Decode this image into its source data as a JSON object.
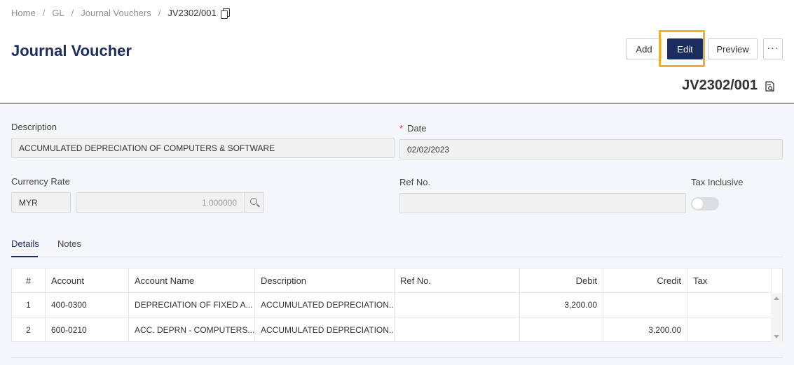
{
  "breadcrumb": {
    "items": [
      "Home",
      "GL",
      "Journal Vouchers"
    ],
    "current": "JV2302/001",
    "separator": "/"
  },
  "page": {
    "title": "Journal Voucher",
    "doc_no": "JV2302/001"
  },
  "toolbar": {
    "add_label": "Add",
    "edit_label": "Edit",
    "preview_label": "Preview",
    "more_label": "···"
  },
  "form": {
    "description_label": "Description",
    "description_value": "ACCUMULATED DEPRECIATION OF COMPUTERS & SOFTWARE",
    "date_label": "Date",
    "date_required_mark": "*",
    "date_value": "02/02/2023",
    "currency_rate_label": "Currency Rate",
    "currency_code": "MYR",
    "currency_rate_value": "1.000000",
    "ref_no_label": "Ref No.",
    "ref_no_value": "",
    "tax_inclusive_label": "Tax Inclusive",
    "tax_inclusive_on": false
  },
  "tabs": [
    {
      "label": "Details",
      "active": true
    },
    {
      "label": "Notes",
      "active": false
    }
  ],
  "table": {
    "columns": [
      "#",
      "Account",
      "Account Name",
      "Description",
      "Ref No.",
      "Debit",
      "Credit",
      "Tax"
    ],
    "rows": [
      {
        "num": "1",
        "account": "400-0300",
        "account_name": "DEPRECIATION OF FIXED A...",
        "description": "ACCUMULATED DEPRECIATION...",
        "ref_no": "",
        "debit": "3,200.00",
        "credit": "",
        "tax": ""
      },
      {
        "num": "2",
        "account": "600-0210",
        "account_name": "ACC. DEPRN - COMPUTERS...",
        "description": "ACCUMULATED DEPRECIATION...",
        "ref_no": "",
        "debit": "",
        "credit": "3,200.00",
        "tax": ""
      }
    ]
  },
  "colors": {
    "primary": "#1b2c5e",
    "highlight": "#f0b02a",
    "required": "#d9342b"
  },
  "icons": {
    "copy": "copy-icon",
    "doc_search": "document-search-icon",
    "search": "search-icon"
  }
}
